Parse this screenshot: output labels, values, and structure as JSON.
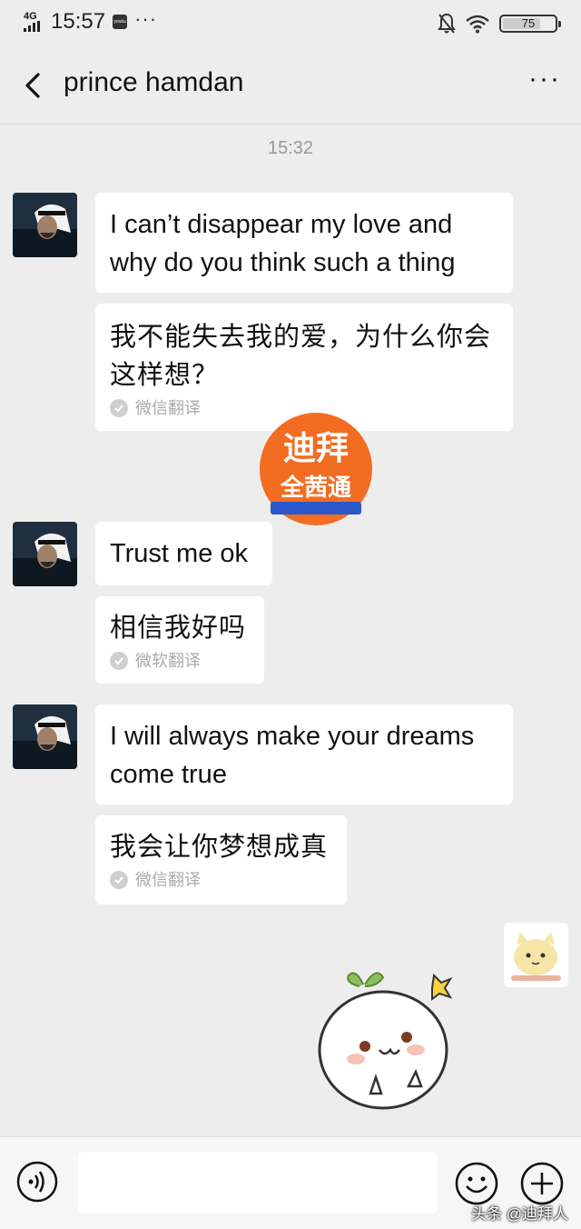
{
  "status_bar": {
    "network": "4G",
    "time": "15:57",
    "app_badge": "youku",
    "dots": "···",
    "battery": 75
  },
  "header": {
    "title": "prince hamdan",
    "more": "···"
  },
  "chat": {
    "timestamp": "15:32",
    "messages": [
      {
        "text": "I can’t disappear my love and why do you think such a thing",
        "translation": "我不能失去我的爱，为什么你会这样想？",
        "translator": "微信翻译"
      },
      {
        "text": "Trust me ok",
        "translation": "相信我好吗",
        "translator": "微软翻译"
      },
      {
        "text": "I will always make your dreams come true",
        "translation": "我会让你梦想成真",
        "translator": "微信翻译"
      }
    ]
  },
  "watermark_logo": {
    "line1": "迪拜",
    "line2": "全茜通"
  },
  "input_bar": {
    "placeholder": ""
  },
  "footer_watermark": "头条 @迪拜人",
  "colors": {
    "background": "#ededed",
    "bubble": "#ffffff",
    "logo_orange": "#f26c22"
  }
}
